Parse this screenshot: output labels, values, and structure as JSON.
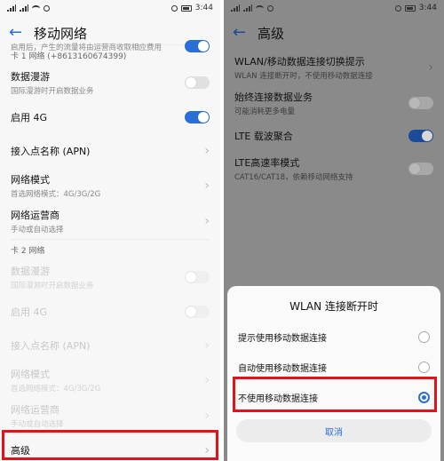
{
  "left": {
    "status": {
      "time": "3:44"
    },
    "title": "移动网络",
    "top_partial_desc": "启用后，产生的流量将由运营商收取相应费用",
    "card1_header": "卡 1 网络 (+8613160674399)",
    "card1_items": [
      {
        "label": "数据漫游",
        "desc": "国际漫游时开启数据业务",
        "control": "toggle",
        "on": false
      },
      {
        "label": "启用 4G",
        "desc": "",
        "control": "toggle",
        "on": true
      },
      {
        "label": "接入点名称 (APN)",
        "desc": "",
        "control": "chevron"
      },
      {
        "label": "网络模式",
        "desc": "首选网络模式：4G/3G/2G",
        "control": "chevron"
      },
      {
        "label": "网络运营商",
        "desc": "手动或自动选择",
        "control": "chevron"
      }
    ],
    "card2_header": "卡 2 网络",
    "card2_items": [
      {
        "label": "数据漫游",
        "desc": "国际漫游时开启数据业务",
        "control": "toggle",
        "on": false
      },
      {
        "label": "启用 4G",
        "desc": "",
        "control": "toggle",
        "on": false
      },
      {
        "label": "接入点名称 (APN)",
        "desc": "",
        "control": "chevron"
      },
      {
        "label": "网络模式",
        "desc": "首选网络模式：4G/3G/2G",
        "control": "chevron"
      },
      {
        "label": "网络运营商",
        "desc": "手动或自动选择",
        "control": "chevron"
      }
    ],
    "advanced_label": "高级"
  },
  "right": {
    "status": {
      "time": "3:44"
    },
    "title": "高级",
    "items": [
      {
        "label": "WLAN/移动数据连接切换提示",
        "desc": "WLAN 连接断开时，不使用移动数据连接",
        "control": "chevron"
      },
      {
        "label": "始终连接数据业务",
        "desc": "可能消耗更多电量",
        "control": "toggle",
        "on": false
      },
      {
        "label": "LTE 载波聚合",
        "desc": "",
        "control": "toggle",
        "on": true
      },
      {
        "label": "LTE高速率模式",
        "desc": "CAT16/CAT18，依赖移动网络支持",
        "control": "toggle",
        "on": false
      }
    ],
    "dialog": {
      "title": "WLAN 连接断开时",
      "options": [
        {
          "label": "提示使用移动数据连接",
          "selected": false
        },
        {
          "label": "自动使用移动数据连接",
          "selected": false
        },
        {
          "label": "不使用移动数据连接",
          "selected": true
        }
      ],
      "cancel": "取消"
    }
  },
  "colors": {
    "accent": "#2a6fd8",
    "highlight": "#e0121c"
  }
}
